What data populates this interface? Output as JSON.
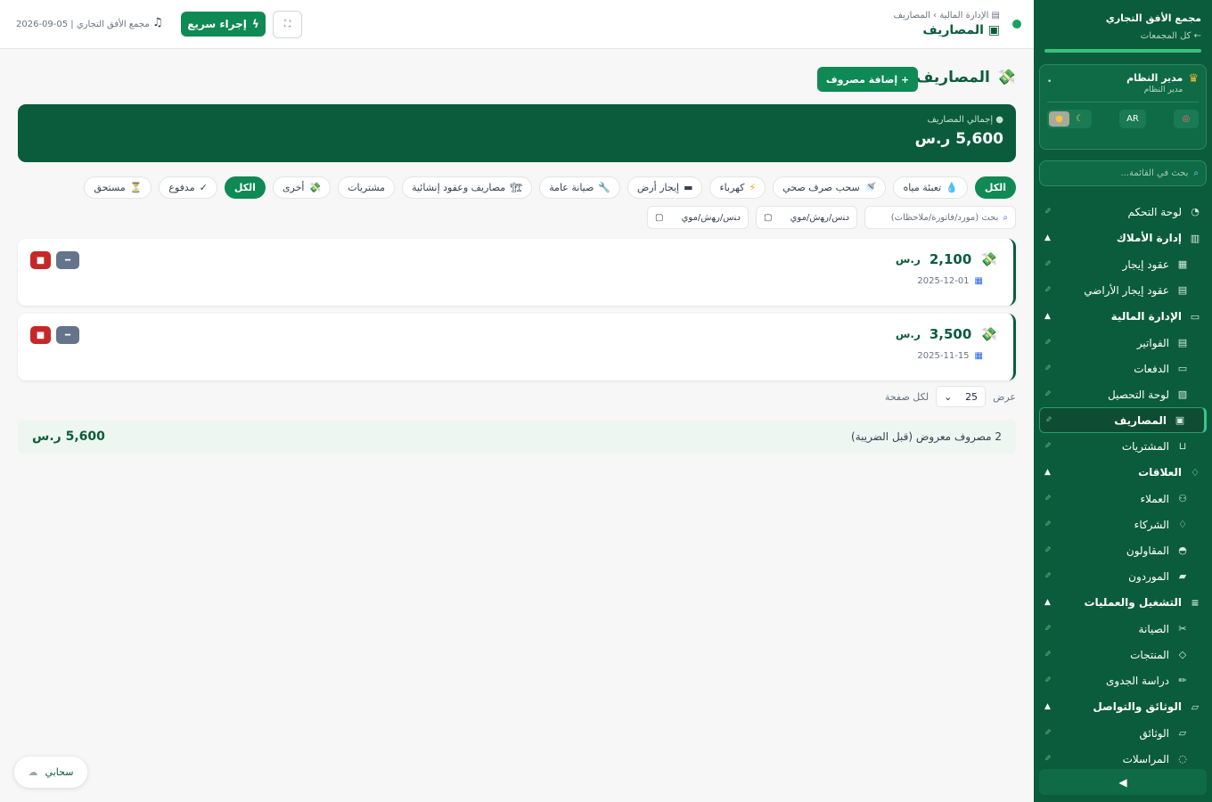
{
  "sidebar": {
    "brand_name": "مجمع الأفق التجاري",
    "back_link": "← كل المجمعات",
    "user": {
      "name": "مدير النظام",
      "role": "مدير النظام",
      "menu_dot": "•"
    },
    "lang_label": "AR",
    "search_placeholder": "بحث في القائمة...",
    "groups": [
      {
        "label": "لوحة التحكم",
        "type": "item"
      },
      {
        "label": "إدارة الأملاك",
        "type": "group",
        "items": [
          "عقود إيجار",
          "عقود إيجار الأراضي"
        ]
      },
      {
        "label": "الإدارة المالية",
        "type": "group",
        "items": [
          "الفواتير",
          "الدفعات",
          "لوحة التحصيل",
          "المصاريف",
          "المشتريات"
        ]
      },
      {
        "label": "العلاقات",
        "type": "group",
        "items": [
          "العملاء",
          "الشركاء",
          "المقاولون",
          "الموردون"
        ]
      },
      {
        "label": "التشغيل والعمليات",
        "type": "group",
        "items": [
          "الصيانة",
          "المنتجات",
          "دراسة الجدوى"
        ]
      },
      {
        "label": "الوثائق والتواصل",
        "type": "group",
        "items": [
          "الوثائق",
          "المراسلات"
        ]
      }
    ],
    "collapse_label": "◀"
  },
  "topbar": {
    "breadcrumb": "الإدارة المالية › المصاريف",
    "page_title": "المصاريف",
    "quick_action": "إجراء سريع",
    "date_org": "2026-09-05 | مجمع الأفق التجاري"
  },
  "main": {
    "title": "المصاريف",
    "add_button": "+ إضافة مصروف",
    "summary_label": "إجمالي المصاريف",
    "summary_value": "5,600 ر.س",
    "type_filters": [
      {
        "label": "الكل",
        "icon": "",
        "active": true
      },
      {
        "label": "تعبئة مياه",
        "icon": "💧"
      },
      {
        "label": "سحب صرف صحي",
        "icon": "🚿"
      },
      {
        "label": "كهرباء",
        "icon": "⚡"
      },
      {
        "label": "إيجار أرض",
        "icon": "▬"
      },
      {
        "label": "صيانة عامة",
        "icon": "🔧"
      },
      {
        "label": "مصاريف وعقود إنشائية",
        "icon": "🏗"
      },
      {
        "label": "مشتريات",
        "icon": ""
      },
      {
        "label": "أخرى",
        "icon": "💸"
      }
    ],
    "status_filters": [
      {
        "label": "الكل",
        "icon": "",
        "active": true
      },
      {
        "label": "مدفوع",
        "icon": "✓"
      },
      {
        "label": "مستحق",
        "icon": "⏳"
      }
    ],
    "search_placeholder": "بحث (مورد/فاتورة/ملاحظات)",
    "date_from_placeholder": "ﺩﻨﺱ/ﺭﻬﺵ/ﻣﻮﻱ",
    "date_to_placeholder": "ﺩﻨﺱ/ﺭﻬﺵ/ﻣﻮﻱ",
    "expenses": [
      {
        "amount": "2,100",
        "currency": "ر.س",
        "date": "2025-12-01"
      },
      {
        "amount": "3,500",
        "currency": "ر.س",
        "date": "2025-11-15"
      }
    ],
    "pager": {
      "show_label": "عرض",
      "per_page": "25",
      "suffix": "لكل صفحة"
    },
    "totals_count": "2 مصروف معروض (قبل الضريبة)",
    "totals_sum": "5,600 ر.س"
  },
  "cloud_label": "سحابي",
  "colors": {
    "primary": "#0b5c3c",
    "accent": "#0f8a55",
    "danger": "#c62828",
    "neutral": "#64748b"
  }
}
